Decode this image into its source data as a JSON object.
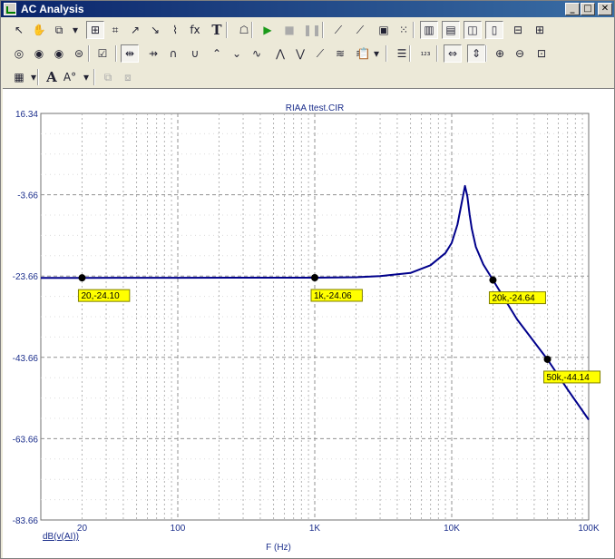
{
  "window": {
    "title": "AC Analysis",
    "controls": [
      "_",
      "□",
      "✕"
    ]
  },
  "toolbar1": [
    {
      "name": "select-arrow-icon",
      "glyph": "↖"
    },
    {
      "name": "pan-hand-icon",
      "glyph": "✋"
    },
    {
      "name": "copy-icon",
      "glyph": "⧉"
    },
    {
      "name": "dropdown-arrow-icon",
      "glyph": "▾"
    },
    {
      "name": "zoom-window-icon",
      "glyph": "⊞",
      "pressed": true
    },
    {
      "name": "axis-settings-icon",
      "glyph": "⌗"
    },
    {
      "name": "curve-edit-icon",
      "glyph": "↗"
    },
    {
      "name": "marker-icon",
      "glyph": "↘"
    },
    {
      "name": "graph-icon",
      "glyph": "⌇"
    },
    {
      "name": "formula-icon",
      "glyph": "fx"
    },
    {
      "name": "text-tool-icon",
      "glyph": "T"
    },
    {
      "name": "properties-icon",
      "glyph": "☖"
    },
    {
      "name": "run-icon",
      "glyph": "▶"
    },
    {
      "name": "stop-icon",
      "glyph": "■"
    },
    {
      "name": "pause-icon",
      "glyph": "❚❚"
    },
    {
      "name": "line-tool-icon",
      "glyph": "⟋"
    },
    {
      "name": "line-delete-icon",
      "glyph": "⟋"
    },
    {
      "name": "frame-icon",
      "glyph": "▣"
    },
    {
      "name": "grid-dots-icon",
      "glyph": "⁙"
    },
    {
      "name": "layout-1-icon",
      "glyph": "▥",
      "pressed": true
    },
    {
      "name": "layout-2-icon",
      "glyph": "▤",
      "pressed": true
    },
    {
      "name": "layout-3-icon",
      "glyph": "◫",
      "pressed": true
    },
    {
      "name": "layout-4-icon",
      "glyph": "▯",
      "pressed": true
    },
    {
      "name": "horizontal-line-icon",
      "glyph": "⊟"
    },
    {
      "name": "grid-plus-icon",
      "glyph": "⊞"
    }
  ],
  "toolbar2": [
    {
      "name": "tracker-icon",
      "glyph": "◎"
    },
    {
      "name": "cursor-1-icon",
      "glyph": "◉"
    },
    {
      "name": "cursor-2-icon",
      "glyph": "◉"
    },
    {
      "name": "cursor-home-icon",
      "glyph": "⊜"
    },
    {
      "name": "data-points-icon",
      "glyph": "☑"
    },
    {
      "name": "next-value-icon",
      "glyph": "⇹",
      "pressed": true
    },
    {
      "name": "next-simulation-icon",
      "glyph": "⇸"
    },
    {
      "name": "peak-icon",
      "glyph": "∩"
    },
    {
      "name": "valley-icon",
      "glyph": "∪"
    },
    {
      "name": "high-icon",
      "glyph": "⌃"
    },
    {
      "name": "low-icon",
      "glyph": "⌄"
    },
    {
      "name": "inflection-icon",
      "glyph": "∿"
    },
    {
      "name": "global-high-icon",
      "glyph": "⋀"
    },
    {
      "name": "global-low-icon",
      "glyph": "⋁"
    },
    {
      "name": "slope-icon",
      "glyph": "⟋"
    },
    {
      "name": "fan-icon",
      "glyph": "≋"
    },
    {
      "name": "fan-up-icon",
      "glyph": "≋"
    },
    {
      "name": "clipboard-icon",
      "glyph": "📋"
    },
    {
      "name": "dropdown-arrow-icon",
      "glyph": "▾"
    },
    {
      "name": "list-icon",
      "glyph": "☰"
    },
    {
      "name": "numeric-icon",
      "glyph": "₁₂₃"
    },
    {
      "name": "fit-icon",
      "glyph": "⇔",
      "pressed": true
    },
    {
      "name": "fit-vertical-icon",
      "glyph": "⇕",
      "pressed": true
    },
    {
      "name": "zoom-in-icon",
      "glyph": "⊕"
    },
    {
      "name": "zoom-out-icon",
      "glyph": "⊖"
    },
    {
      "name": "zoom-100-icon",
      "glyph": "⊡"
    }
  ],
  "toolbar3": [
    {
      "name": "table-icon",
      "glyph": "▦"
    },
    {
      "name": "dropdown-arrow-icon",
      "glyph": "▾"
    },
    {
      "name": "font-icon",
      "glyph": "A"
    },
    {
      "name": "font-size-icon",
      "glyph": "A°"
    },
    {
      "name": "dropdown-arrow-icon",
      "glyph": "▾"
    },
    {
      "name": "tile-icon",
      "glyph": "⧉"
    },
    {
      "name": "cascade-icon",
      "glyph": "⧈"
    }
  ],
  "chart_data": {
    "type": "line",
    "title": "RIAA ttest.CIR",
    "xlabel": "F (Hz)",
    "ylabel": "dB(v(AI))",
    "xscale": "log",
    "xlim": [
      10,
      100000
    ],
    "ylim": [
      -83.66,
      16.34
    ],
    "y_ticks": [
      16.34,
      -3.66,
      -23.66,
      -43.66,
      -63.66,
      -83.66
    ],
    "y_tick_labels": [
      "16.34",
      "-3.66",
      "-23.66",
      "-43.66",
      "-63.66",
      "-83.66"
    ],
    "x_ticks": [
      20,
      100,
      1000,
      10000,
      100000
    ],
    "x_tick_labels": [
      "20",
      "100",
      "1K",
      "10K",
      "100K"
    ],
    "grid": true,
    "line_color": "#00008b",
    "series": [
      {
        "x": [
          10,
          20,
          100,
          500,
          1000,
          2000,
          3000,
          5000,
          7000,
          9000,
          10000,
          11000,
          12000,
          12500,
          13000,
          13500,
          14000,
          15000,
          17000,
          20000,
          30000,
          50000,
          70000,
          100000
        ],
        "y": [
          -24.1,
          -24.1,
          -24.08,
          -24.07,
          -24.06,
          -23.95,
          -23.65,
          -22.9,
          -21.0,
          -18.0,
          -15.5,
          -11.0,
          -4.5,
          -1.5,
          -4.0,
          -8.5,
          -12.0,
          -16.5,
          -20.8,
          -24.64,
          -34.3,
          -44.14,
          -51.5,
          -59.0
        ]
      }
    ],
    "cursors": [
      {
        "x": 20,
        "y": -24.1,
        "label": "20,-24.10"
      },
      {
        "x": 1000,
        "y": -24.06,
        "label": "1k,-24.06"
      },
      {
        "x": 20000,
        "y": -24.64,
        "label": "20k,-24.64"
      },
      {
        "x": 50000,
        "y": -44.14,
        "label": "50k,-44.14"
      }
    ]
  }
}
